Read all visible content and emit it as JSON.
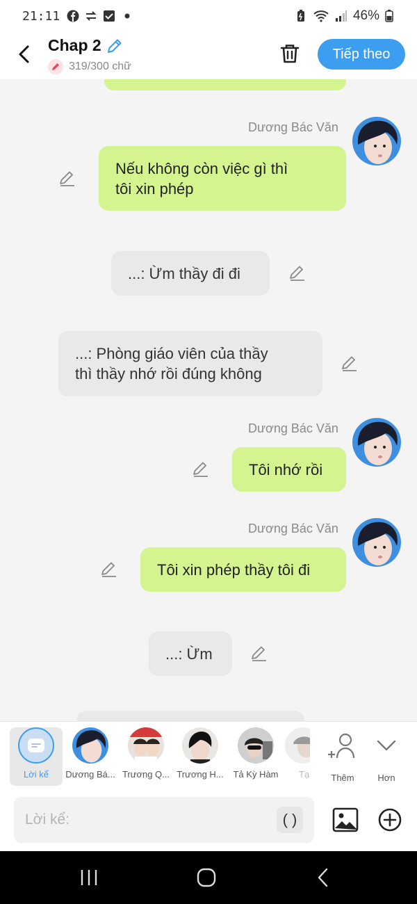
{
  "status_bar": {
    "time": "21:11",
    "battery": "46%",
    "icons_left": [
      "facebook-icon",
      "transfer-icon",
      "checkbox-icon",
      "dot-icon"
    ],
    "icons_right": [
      "battery-saver-icon",
      "wifi-icon",
      "signal-icon",
      "battery-icon"
    ]
  },
  "header": {
    "title": "Chap 2",
    "word_count": "319/300 chữ",
    "next_button": "Tiếp theo",
    "colors": {
      "accent": "#3d9df0",
      "count_badge": "#fde1e4"
    }
  },
  "messages": [
    {
      "type": "green-partial",
      "text": ""
    },
    {
      "type": "character",
      "name": "Dương Bác Văn",
      "lines": [
        "Nếu không còn việc gì thì",
        "tôi xin phép"
      ]
    },
    {
      "type": "narration",
      "lines": [
        "...: Ừm thầy đi đi"
      ]
    },
    {
      "type": "narration",
      "lines": [
        "...: Phòng giáo viên của thầy",
        "thì thầy nhớ rồi đúng không"
      ]
    },
    {
      "type": "character",
      "name": "Dương Bác Văn",
      "lines": [
        "Tôi nhớ rồi"
      ]
    },
    {
      "type": "character",
      "name": "Dương Bác Văn",
      "lines": [
        "Tôi xin phép thầy tôi đi"
      ]
    },
    {
      "type": "narration",
      "lines": [
        "...: Ừm"
      ]
    }
  ],
  "characters": [
    {
      "label": "Lời kể",
      "selected": true
    },
    {
      "label": "Dương Bá..."
    },
    {
      "label": "Trương Q..."
    },
    {
      "label": "Trương H..."
    },
    {
      "label": "Tả Kỳ Hàm"
    },
    {
      "label": "Tạ"
    }
  ],
  "actions": {
    "add": "Thêm",
    "more": "Hơn"
  },
  "input": {
    "placeholder": "Lời kể:",
    "paren_button": "( )"
  },
  "colors": {
    "bubble_green": "#d4f48f",
    "bubble_gray": "#e9e9e9",
    "background": "#f4f4f4"
  }
}
